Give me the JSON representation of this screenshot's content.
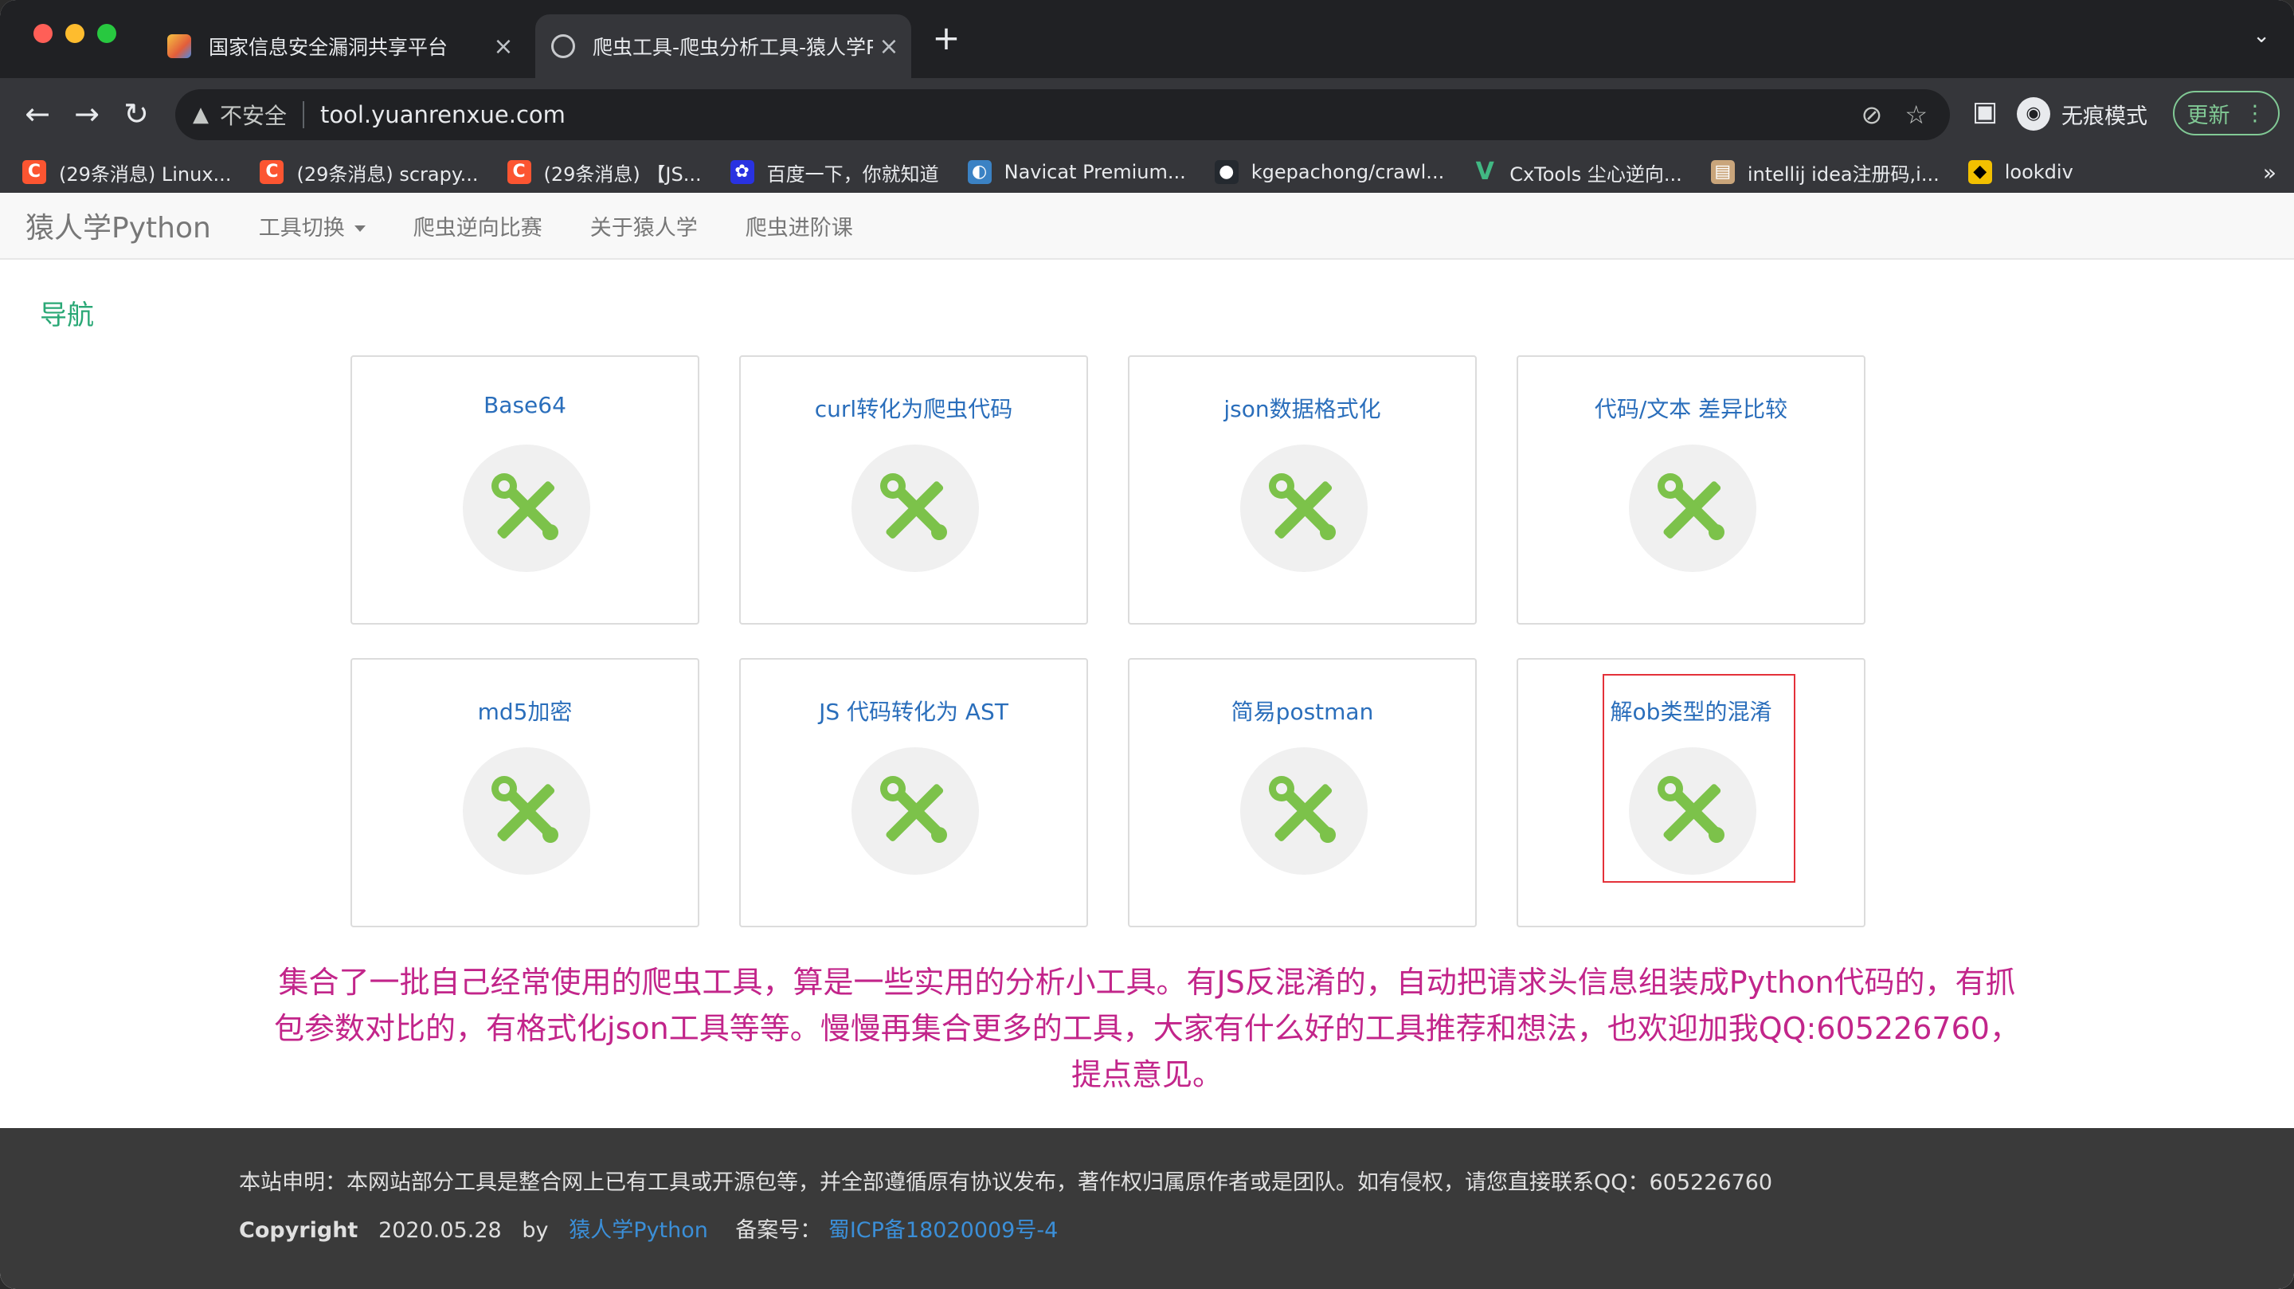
{
  "browser": {
    "tabs": [
      {
        "title": "国家信息安全漏洞共享平台",
        "close": "×"
      },
      {
        "title": "爬虫工具-爬虫分析工具-猿人学P",
        "close": "×"
      }
    ],
    "new_tab": "+",
    "tab_list": "⌄",
    "address": {
      "warning": "▲",
      "insecure_label": "不安全",
      "url": "tool.yuanrenxue.com"
    },
    "incognito_label": "无痕模式",
    "update_label": "更新",
    "bookmarks": [
      {
        "label": "(29条消息) Linux...",
        "icon": "csdn-icon"
      },
      {
        "label": "(29条消息) scrapy...",
        "icon": "csdn-icon"
      },
      {
        "label": "(29条消息) 【JS...",
        "icon": "csdn-icon"
      },
      {
        "label": "百度一下，你就知道",
        "icon": "baidu-icon"
      },
      {
        "label": "Navicat Premium...",
        "icon": "navicat-icon"
      },
      {
        "label": "kgepachong/crawl...",
        "icon": "github-icon"
      },
      {
        "label": "CxTools 尘心逆向...",
        "icon": "vue-icon"
      },
      {
        "label": "intellij idea注册码,i...",
        "icon": "idea-icon"
      },
      {
        "label": "lookdiv",
        "icon": "lookdiv-icon"
      }
    ],
    "bookmarks_more": "»"
  },
  "site": {
    "brand": "猿人学Python",
    "nav": [
      "工具切换",
      "爬虫逆向比赛",
      "关于猿人学",
      "爬虫进阶课"
    ],
    "heading": "导航",
    "tools": [
      {
        "title": "Base64"
      },
      {
        "title": "curl转化为爬虫代码"
      },
      {
        "title": "json数据格式化"
      },
      {
        "title": "代码/文本 差异比较"
      },
      {
        "title": "md5加密"
      },
      {
        "title": "JS 代码转化为 AST"
      },
      {
        "title": "简易postman"
      },
      {
        "title": "解ob类型的混淆"
      }
    ],
    "promo": "集合了一批自己经常使用的爬虫工具，算是一些实用的分析小工具。有JS反混淆的，自动把请求头信息组装成Python代码的，有抓包参数对比的，有格式化json工具等等。慢慢再集合更多的工具，大家有什么好的工具推荐和想法，也欢迎加我QQ:605226760，提点意见。",
    "footer": {
      "statement": "本站申明：本网站部分工具是整合网上已有工具或开源包等，并全部遵循原有协议发布，著作权归属原作者或是团队。如有侵权，请您直接联系QQ：605226760",
      "copyright_label": "Copyright",
      "copyright_date": "2020.05.28",
      "by": "by",
      "author": "猿人学Python",
      "icp_label": "备案号：",
      "icp": "蜀ICP备18020009号-4"
    }
  },
  "colors": {
    "accent_green": "#2aa876",
    "link_blue": "#2a6ebb",
    "promo_magenta": "#c2258a",
    "highlight_red": "#e4313a",
    "tool_icon_green": "#7cc24a"
  }
}
